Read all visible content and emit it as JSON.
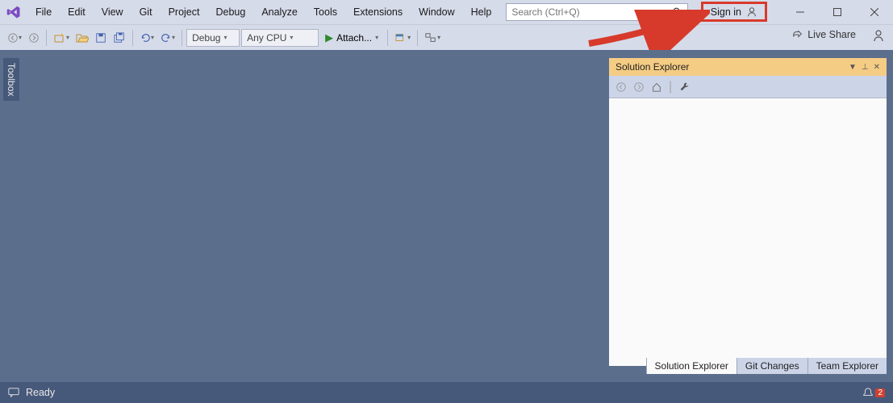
{
  "menu": {
    "items": [
      "File",
      "Edit",
      "View",
      "Git",
      "Project",
      "Debug",
      "Analyze",
      "Tools",
      "Extensions",
      "Window",
      "Help"
    ],
    "search_placeholder": "Search (Ctrl+Q)",
    "signin": "Sign in"
  },
  "toolbar": {
    "config": "Debug",
    "platform": "Any CPU",
    "attach": "Attach...",
    "liveshare": "Live Share"
  },
  "sidebar": {
    "toolbox": "Toolbox"
  },
  "solution_explorer": {
    "title": "Solution Explorer",
    "tabs": [
      "Solution Explorer",
      "Git Changes",
      "Team Explorer"
    ]
  },
  "status": {
    "ready": "Ready",
    "notifications": "2"
  }
}
